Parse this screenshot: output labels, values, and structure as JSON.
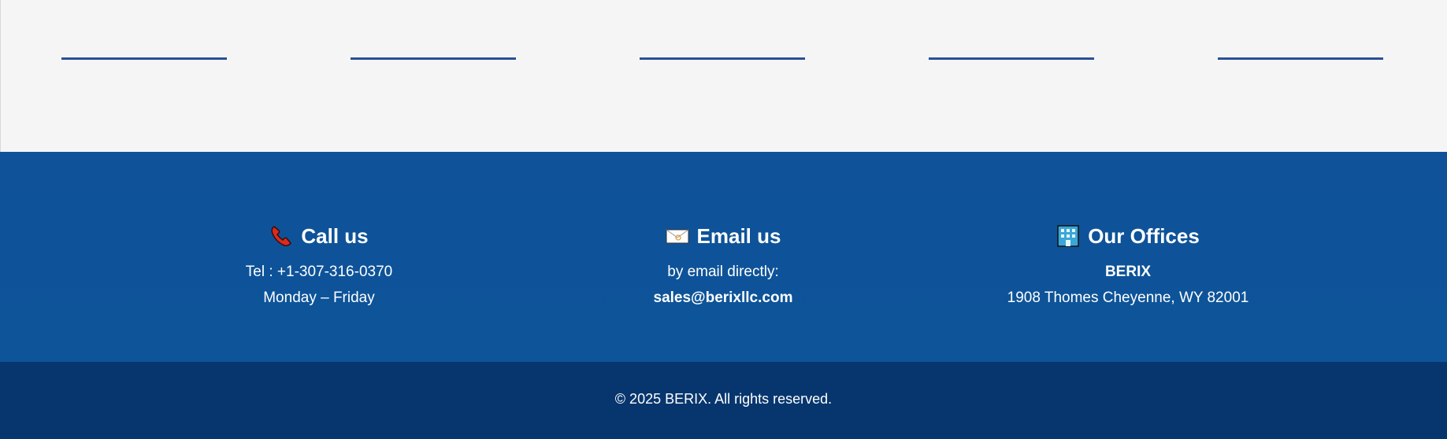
{
  "contact": {
    "call": {
      "icon": "telephone-icon",
      "title": "Call us",
      "line1": "Tel : +1-307-316-0370",
      "line2": "Monday – Friday"
    },
    "email": {
      "icon": "envelope-icon",
      "title": "Email us",
      "line1": "by email directly:",
      "line2": "sales@berixllc.com"
    },
    "offices": {
      "icon": "office-building-icon",
      "title": "Our Offices",
      "line1": "BERIX",
      "line2": "1908 Thomes Cheyenne, WY 82001"
    }
  },
  "footer": {
    "copyright": "© 2025 BERIX. All rights reserved."
  },
  "colors": {
    "divider": "#2a4f97",
    "contact_band": "#0f5299",
    "footer_bar": "#07366e"
  }
}
